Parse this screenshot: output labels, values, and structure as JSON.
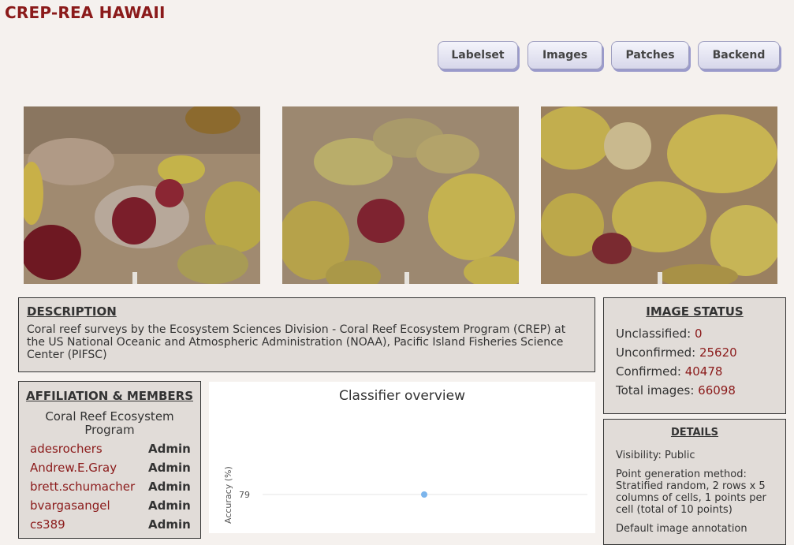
{
  "header": {
    "title": "CREP-REA HAWAII"
  },
  "nav": {
    "labelset": "Labelset",
    "images": "Images",
    "patches": "Patches",
    "backend": "Backend"
  },
  "description": {
    "heading": "DESCRIPTION",
    "text": "Coral reef surveys by the Ecosystem Sciences Division - Coral Reef Ecosystem Program (CREP) at the US National Oceanic and Atmospheric Administration (NOAA), Pacific Island Fisheries Science Center (PIFSC)"
  },
  "image_status": {
    "heading": "IMAGE STATUS",
    "unclassified_label": "Unclassified:",
    "unclassified": "0",
    "unconfirmed_label": "Unconfirmed:",
    "unconfirmed": "25620",
    "confirmed_label": "Confirmed:",
    "confirmed": "40478",
    "total_label": "Total images:",
    "total": "66098"
  },
  "affiliation": {
    "heading": "AFFILIATION & MEMBERS",
    "org": "Coral Reef Ecosystem Program",
    "members": [
      {
        "name": "adesrochers",
        "role": "Admin"
      },
      {
        "name": "Andrew.E.Gray",
        "role": "Admin"
      },
      {
        "name": "brett.schumacher",
        "role": "Admin"
      },
      {
        "name": "bvargasangel",
        "role": "Admin"
      },
      {
        "name": "cs389",
        "role": "Admin"
      }
    ]
  },
  "details": {
    "heading": "DETAILS",
    "visibility": "Visibility: Public",
    "point_method": "Point generation method: Stratified random, 2 rows x 5 columns of cells, 1 points per cell (total of 10 points)",
    "default_annotation": "Default image annotation"
  },
  "chart_data": {
    "type": "scatter",
    "title": "Classifier overview",
    "ylabel": "Accuracy (%)",
    "yticks": [
      79
    ],
    "series": [
      {
        "values": [
          79
        ]
      }
    ],
    "point_color": "#7cb5ec"
  }
}
